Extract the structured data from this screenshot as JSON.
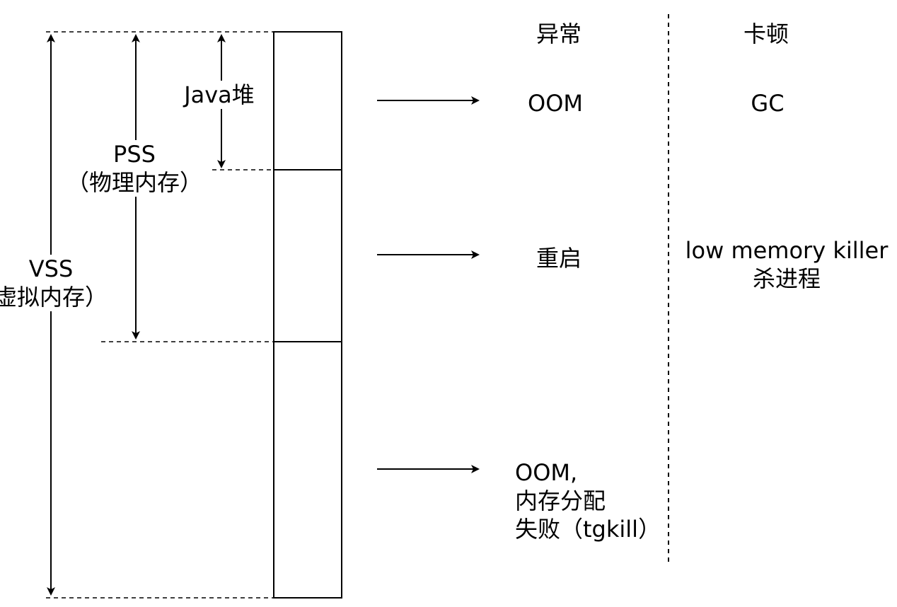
{
  "diagram": {
    "vss": {
      "name": "VSS",
      "desc": "虚拟内存）"
    },
    "pss": {
      "name": "PSS",
      "desc": "（物理内存）"
    },
    "java_heap": "Java堆",
    "columns": {
      "exception": "异常",
      "stutter": "卡顿"
    },
    "rows": [
      {
        "exception": "OOM",
        "stutter": "GC"
      },
      {
        "exception": "重启",
        "stutter_line1": "low memory killer",
        "stutter_line2": "杀进程"
      },
      {
        "exception_line1": "OOM,",
        "exception_line2": "内存分配",
        "exception_line3": "失败（tgkill）"
      }
    ],
    "colors": {
      "line": "#000000",
      "background": "#ffffff"
    }
  }
}
